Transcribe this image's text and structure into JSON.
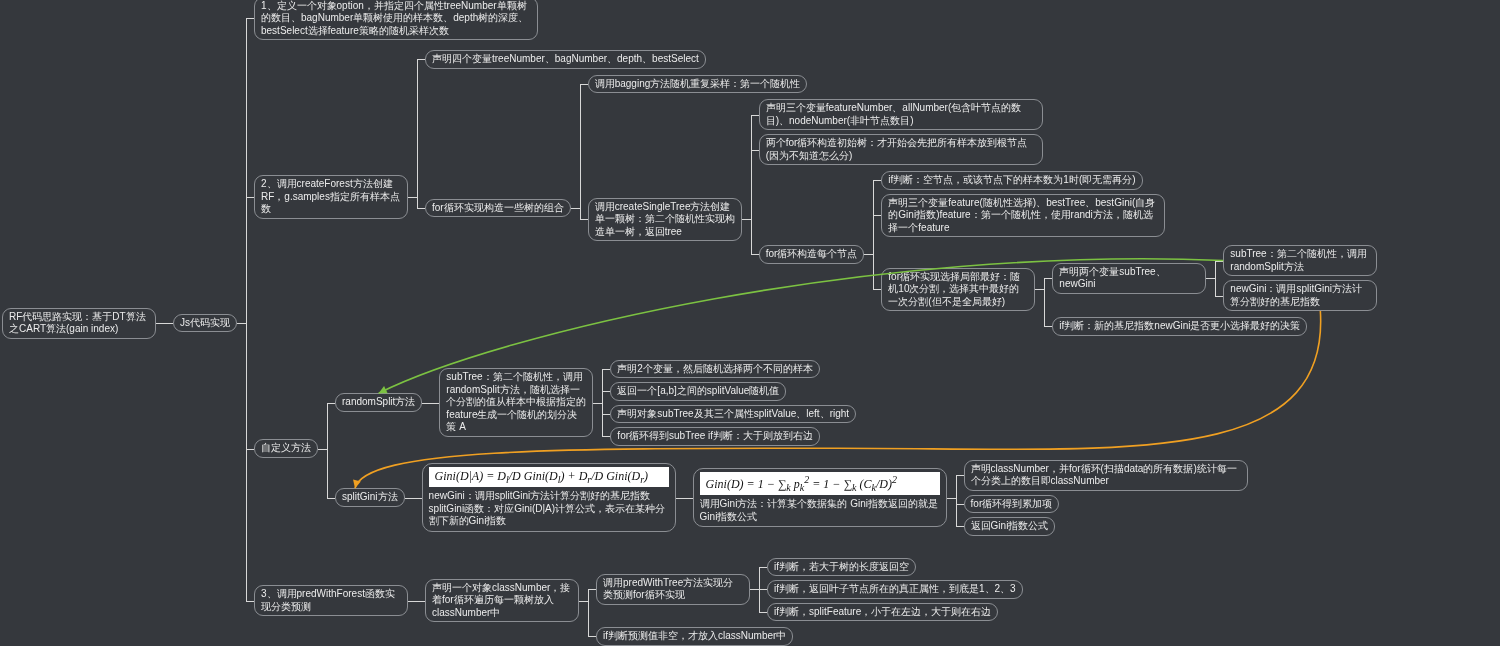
{
  "mind_map": {
    "kind": "topic",
    "text": "RF代码思路实现：基于DT算法之CART算法(gain index)",
    "children": [
      {
        "kind": "topic",
        "text": "Js代码实现",
        "children": [
          {
            "kind": "topic",
            "text": "1、定义一个对象option，并指定四个属性treeNumber单颗树的数目、bagNumber单颗树使用的样本数、depth树的深度、bestSelect选择feature策略的随机采样次数"
          },
          {
            "kind": "topic",
            "text": "2、调用createForest方法创建RF，g.samples指定所有样本点数",
            "children": [
              {
                "kind": "topic",
                "text": "声明四个变量treeNumber、bagNumber、depth、bestSelect"
              },
              {
                "kind": "topic",
                "text": "for循环实现构造一些树的组合",
                "children": [
                  {
                    "kind": "topic",
                    "text": "调用bagging方法随机重复采样：第一个随机性"
                  },
                  {
                    "kind": "topic",
                    "text": "调用createSingleTree方法创建单一颗树：第二个随机性实现构造单一树，返回tree",
                    "children": [
                      {
                        "kind": "topic",
                        "text": "声明三个变量featureNumber、allNumber(包含叶节点的数目)、nodeNumber(非叶节点数目)"
                      },
                      {
                        "kind": "topic",
                        "text": "两个for循环构造初始树：才开始会先把所有样本放到根节点(因为不知道怎么分)"
                      },
                      {
                        "kind": "topic",
                        "text": "for循环构造每个节点",
                        "children": [
                          {
                            "kind": "topic",
                            "text": "if判断：空节点，或该节点下的样本数为1时(即无需再分)"
                          },
                          {
                            "kind": "topic",
                            "text": "声明三个变量feature(随机性选择)、bestTree、bestGini(自身的Gini指数)feature：第一个随机性，使用randi方法，随机选择一个feature"
                          },
                          {
                            "kind": "topic",
                            "text": "for循环实现选择局部最好：随机10次分割，选择其中最好的一次分割(但不是全局最好)",
                            "children": [
                              {
                                "kind": "topic",
                                "text": "声明两个变量subTree、newGini",
                                "children": [
                                  {
                                    "kind": "topic",
                                    "text": "subTree：第二个随机性，调用randomSplit方法"
                                  },
                                  {
                                    "kind": "topic",
                                    "text": "newGini：调用splitGini方法计算分割好的基尼指数"
                                  }
                                ]
                              },
                              {
                                "kind": "topic",
                                "text": "if判断：新的基尼指数newGini是否更小选择最好的决策"
                              }
                            ]
                          }
                        ]
                      }
                    ]
                  }
                ]
              }
            ]
          },
          {
            "kind": "topic",
            "text": "自定义方法",
            "children": [
              {
                "kind": "topic",
                "text": "randomSplit方法",
                "children": [
                  {
                    "kind": "topic",
                    "text": "subTree：第二个随机性，调用randomSplit方法，随机选择一个分割的值从样本中根据指定的feature生成一个随机的划分决策 A",
                    "children": [
                      {
                        "kind": "topic",
                        "text": "声明2个变量，然后随机选择两个不同的样本"
                      },
                      {
                        "kind": "topic",
                        "text": "返回一个[a,b]之间的splitValue随机值"
                      },
                      {
                        "kind": "topic",
                        "text": "声明对象subTree及其三个属性splitValue、left、right"
                      },
                      {
                        "kind": "topic",
                        "text": "for循环得到subTree if判断：大于则放到右边"
                      }
                    ]
                  }
                ]
              },
              {
                "kind": "topic",
                "text": "splitGini方法",
                "children": [
                  {
                    "kind": "formula",
                    "formula": "Gini(D|A) = D$_{l}$/D Gini(D$_{l}$) + D$_{r}$/D Gini(D$_{r}$)",
                    "text": "newGini：调用splitGini方法计算分割好的基尼指数splitGini函数：对应Gini(D|A)计算公式，表示在某种分割下新的Gini指数",
                    "children": [
                      {
                        "kind": "formula",
                        "formula": "Gini(D) = 1 − ∑$_{k}$ p$_{k}$$^{2}$ = 1 − ∑$_{k}$ (C$_{k}$/D)$^{2}$",
                        "text": "调用Gini方法：计算某个数据集的 Gini指数返回的就是Gini指数公式",
                        "children": [
                          {
                            "kind": "topic",
                            "text": "声明classNumber，并for循环(扫描data的所有数据)统计每一个分类上的数目即classNumber"
                          },
                          {
                            "kind": "topic",
                            "text": "for循环得到累加项"
                          },
                          {
                            "kind": "topic",
                            "text": "返回Gini指数公式"
                          }
                        ]
                      }
                    ]
                  }
                ]
              }
            ]
          },
          {
            "kind": "topic",
            "text": "3、调用predWithForest函数实现分类预测",
            "children": [
              {
                "kind": "topic",
                "text": "声明一个对象classNumber，接着for循环遍历每一颗树放入classNumber中",
                "children": [
                  {
                    "kind": "topic",
                    "text": "调用predWithTree方法实现分类预测for循环实现",
                    "children": [
                      {
                        "kind": "topic",
                        "text": "if判断，若大于树的长度返回空"
                      },
                      {
                        "kind": "topic",
                        "text": "if判断，返回叶子节点所在的真正属性，到底是1、2、3"
                      },
                      {
                        "kind": "topic",
                        "text": "if判断，splitFeature，小于在左边，大于则在右边"
                      }
                    ]
                  },
                  {
                    "kind": "topic",
                    "text": "if判断预测值非空，才放入classNumber中"
                  }
                ]
              }
            ]
          }
        ]
      }
    ]
  }
}
